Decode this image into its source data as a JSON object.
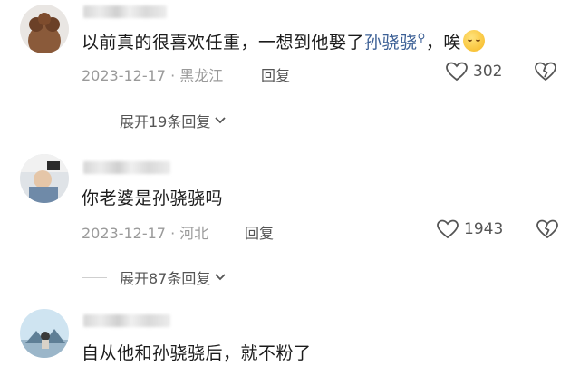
{
  "comments": [
    {
      "text_before": "以前真的很喜欢任重，一想到他娶了",
      "mention": "孙骁骁",
      "text_after": "，唉",
      "date": "2023-12-17",
      "location": "黑龙江",
      "reply_label": "回复",
      "likes": "302",
      "expand_label": "展开19条回复"
    },
    {
      "text": "你老婆是孙骁骁吗",
      "date": "2023-12-17",
      "location": "河北",
      "reply_label": "回复",
      "likes": "1943",
      "expand_label": "展开87条回复"
    },
    {
      "text": "自从他和孙骁骁后，就不粉了"
    }
  ],
  "colors": {
    "mention": "#3b5f95",
    "meta": "#9a9a9a"
  }
}
